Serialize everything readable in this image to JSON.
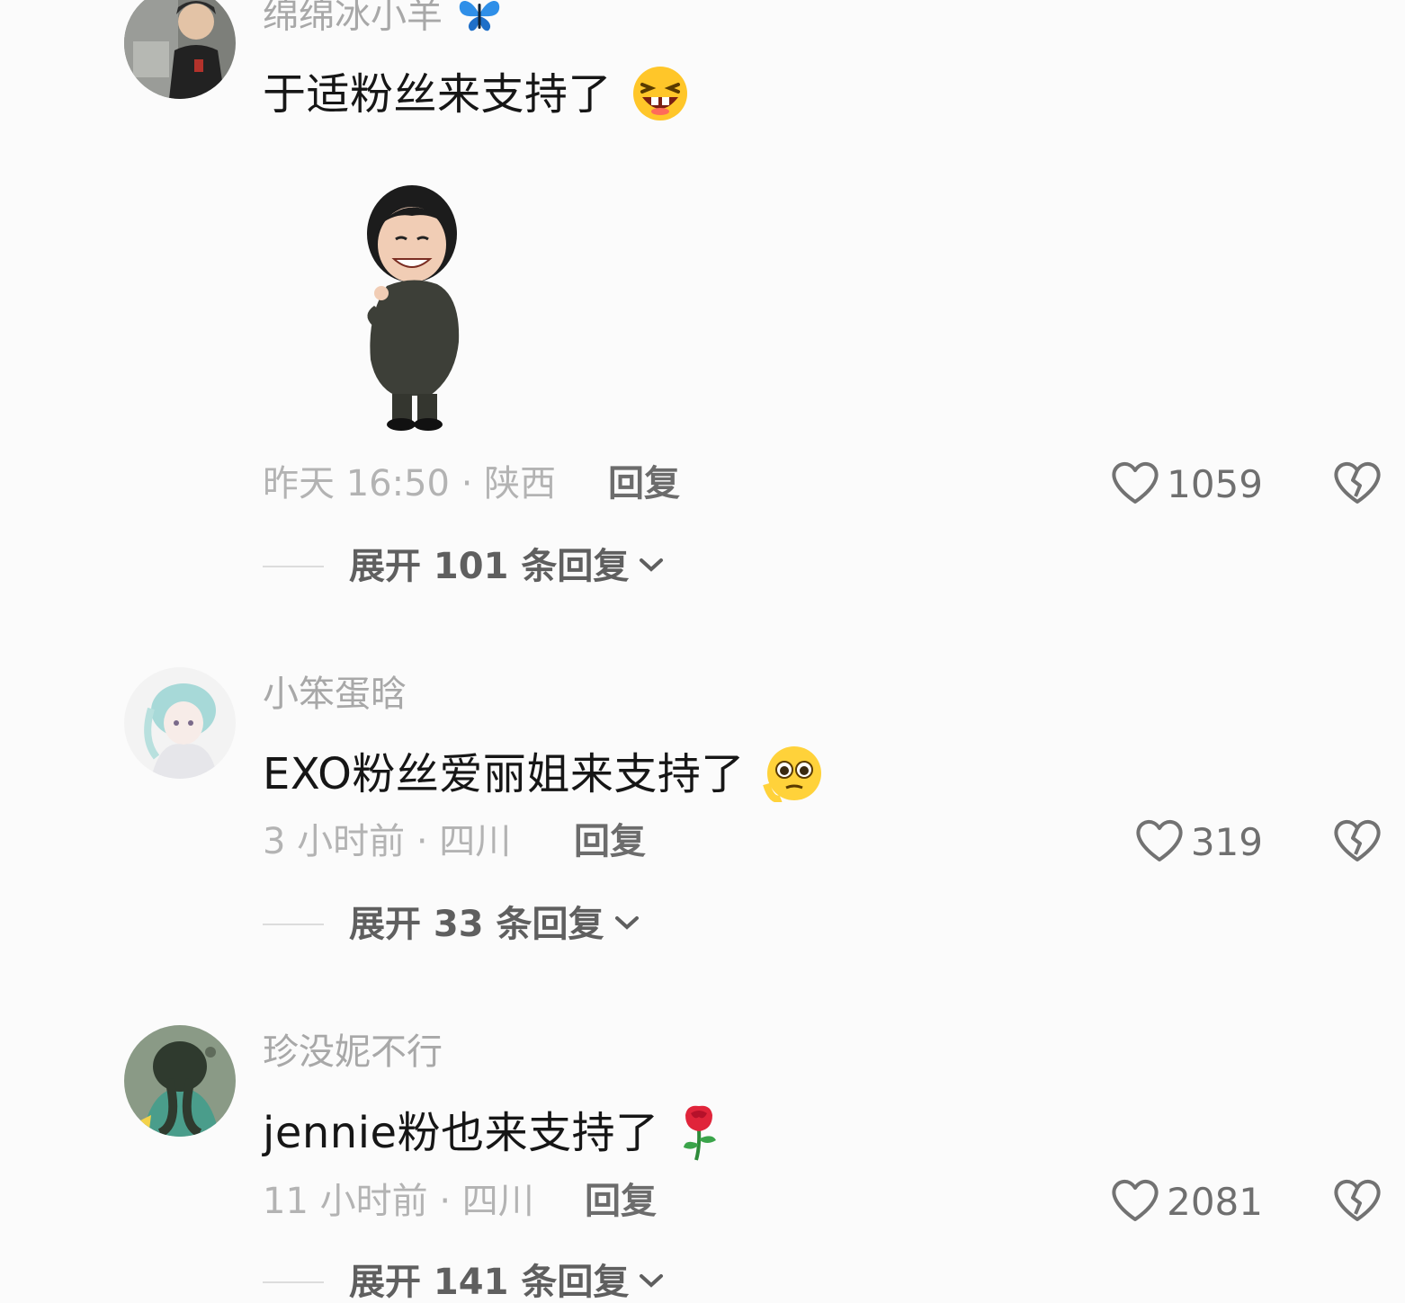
{
  "comments": [
    {
      "username": "绵绵冰小羊",
      "username_emoji": "blue-butterfly-icon",
      "text": "于适粉丝来支持了",
      "text_emoji": "laughing-face-emoji",
      "has_sticker": true,
      "meta": "昨天 16:50 · 陕西",
      "reply_label": "回复",
      "likes": "1059",
      "expand_label": "展开 101 条回复"
    },
    {
      "username": "小笨蛋晗",
      "text": "EXO粉丝爱丽姐来支持了",
      "text_emoji": "pleading-face-emoji",
      "meta": "3 小时前 · 四川",
      "reply_label": "回复",
      "likes": "319",
      "expand_label": "展开 33 条回复"
    },
    {
      "username": "珍没妮不行",
      "text": "jennie粉也来支持了",
      "text_emoji": "rose-emoji",
      "meta": "11 小时前 · 四川",
      "reply_label": "回复",
      "likes": "2081",
      "expand_label": "展开 141 条回复"
    }
  ],
  "colors": {
    "background": "#fbfbfb",
    "username": "#a8a8a8",
    "text": "#161616",
    "meta": "#b3b3b3"
  }
}
